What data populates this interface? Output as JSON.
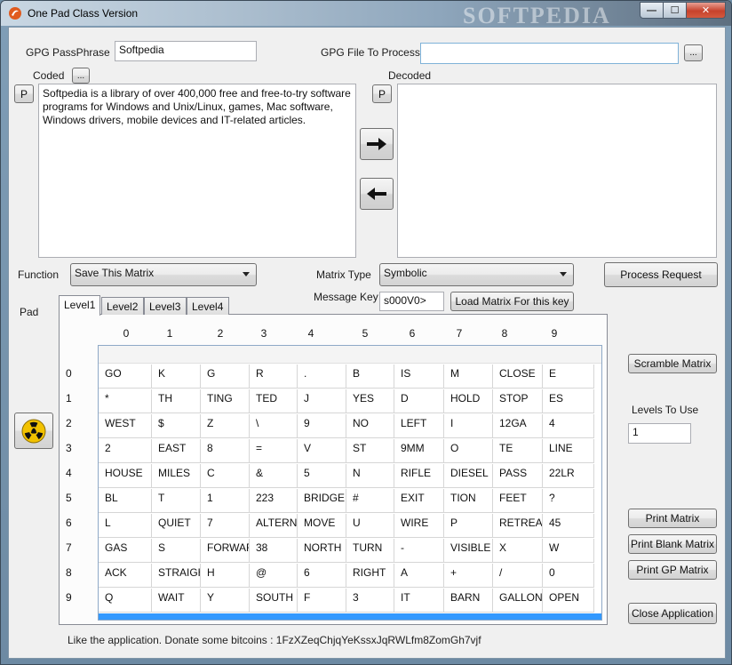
{
  "window": {
    "title": "One Pad Class Version",
    "watermark": "SOFTPEDIA",
    "min_label": "—",
    "max_label": "☐",
    "close_label": "✕"
  },
  "passphrase": {
    "label": "GPG PassPhrase",
    "value": "Softpedia"
  },
  "gpg_file": {
    "label": "GPG File To Process",
    "value": "",
    "browse_label": "..."
  },
  "coded": {
    "label": "Coded",
    "browse_label": "...",
    "p_label": "P",
    "text": "Softpedia is a library of over 400,000 free and free-to-try software programs for Windows and Unix/Linux, games, Mac software, Windows drivers, mobile devices and IT-related articles."
  },
  "decoded": {
    "label": "Decoded",
    "p_label": "P",
    "text": ""
  },
  "function": {
    "label": "Function",
    "selected": "Save This Matrix"
  },
  "matrix_type": {
    "label": "Matrix Type",
    "selected": "Symbolic"
  },
  "message_key": {
    "label": "Message Key",
    "value": "s000V0>",
    "load_label": "Load Matrix For this key"
  },
  "process_label": "Process Request",
  "pad_label": "Pad",
  "tabs": [
    "Level1",
    "Level2",
    "Level3",
    "Level4"
  ],
  "columns": [
    "0",
    "1",
    "2",
    "3",
    "4",
    "5",
    "6",
    "7",
    "8",
    "9"
  ],
  "rows": [
    {
      "index": "0",
      "cells": [
        "GO",
        "K",
        "G",
        "R",
        ".",
        "B",
        "IS",
        "M",
        "CLOSE",
        "E"
      ]
    },
    {
      "index": "1",
      "cells": [
        "*",
        "TH",
        "TING",
        "TED",
        "J",
        "YES",
        "D",
        "HOLD",
        "STOP",
        "ES"
      ]
    },
    {
      "index": "2",
      "cells": [
        "WEST",
        "$",
        "Z",
        "\\",
        "9",
        "NO",
        "LEFT",
        "I",
        "12GA",
        "4"
      ]
    },
    {
      "index": "3",
      "cells": [
        "2",
        "EAST",
        "8",
        "=",
        "V",
        "ST",
        "9MM",
        "O",
        "TE",
        "LINE"
      ]
    },
    {
      "index": "4",
      "cells": [
        "HOUSE",
        "MILES",
        "C",
        "&",
        "5",
        "N",
        "RIFLE",
        "DIESEL",
        "PASS",
        "22LR"
      ]
    },
    {
      "index": "5",
      "cells": [
        "BL",
        "T",
        "1",
        "223",
        "BRIDGE",
        "#",
        "EXIT",
        "TION",
        "FEET",
        "?"
      ]
    },
    {
      "index": "6",
      "cells": [
        "L",
        "QUIET",
        "7",
        "ALTERNA",
        "MOVE",
        "U",
        "WIRE",
        "P",
        "RETREAT",
        "45"
      ]
    },
    {
      "index": "7",
      "cells": [
        "GAS",
        "S",
        "FORWAR",
        "38",
        "NORTH",
        "TURN",
        "-",
        "VISIBLE",
        "X",
        "W"
      ]
    },
    {
      "index": "8",
      "cells": [
        "ACK",
        "STRAIGH",
        "H",
        "@",
        "6",
        "RIGHT",
        "A",
        "+",
        "/",
        "0"
      ]
    },
    {
      "index": "9",
      "cells": [
        "Q",
        "WAIT",
        "Y",
        "SOUTH",
        "F",
        "3",
        "IT",
        "BARN",
        "GALLONS",
        "OPEN"
      ]
    }
  ],
  "scramble_label": "Scramble Matrix",
  "levels": {
    "label": "Levels To Use",
    "value": "1"
  },
  "print_matrix_label": "Print Matrix",
  "print_blank_label": "Print Blank Matrix",
  "print_gp_label": "Print GP Matrix",
  "close_app_label": "Close Application",
  "footer": "Like the application. Donate some bitcoins : 1FzXZeqChjqYeKssxJqRWLfm8ZomGh7vjf",
  "colors": {
    "selection": "#3399ff",
    "nuclear": "#f2c200"
  },
  "icons": [
    "app-icon",
    "arrow-right-icon",
    "arrow-left-icon",
    "radiation-icon"
  ]
}
